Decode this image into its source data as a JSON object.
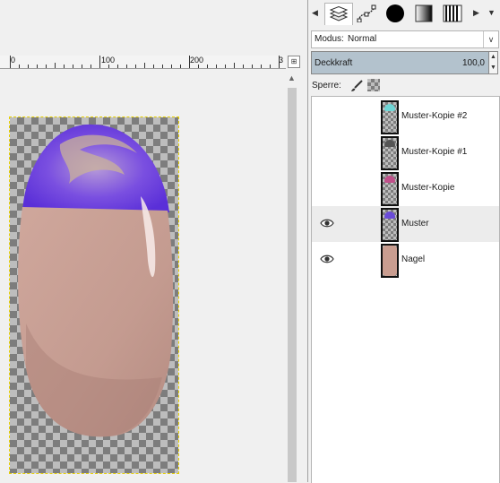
{
  "ruler": {
    "labels": [
      "0",
      "100",
      "200",
      "3"
    ]
  },
  "layers_panel": {
    "tabs": [
      {
        "name": "layers-tab",
        "icon": "layers-icon"
      },
      {
        "name": "paths-tab",
        "icon": "paths-icon"
      },
      {
        "name": "brushes-tab",
        "icon": "brush-circle-icon"
      },
      {
        "name": "gradients-tab",
        "icon": "gradient-icon"
      },
      {
        "name": "patterns-tab",
        "icon": "pattern-icon"
      }
    ],
    "mode_label": "Modus:",
    "mode_value": "Normal",
    "opacity_label": "Deckkraft",
    "opacity_value": "100,0",
    "lock_label": "Sperre:",
    "layers": [
      {
        "name": "Muster-Kopie #2",
        "visible": false,
        "selected": false,
        "thumb_color": "#6fd6d6"
      },
      {
        "name": "Muster-Kopie #1",
        "visible": false,
        "selected": false,
        "thumb_color": "#555555"
      },
      {
        "name": "Muster-Kopie",
        "visible": false,
        "selected": false,
        "thumb_color": "#c0508a"
      },
      {
        "name": "Muster",
        "visible": true,
        "selected": true,
        "thumb_color": "#6a4bd8"
      },
      {
        "name": "Nagel",
        "visible": true,
        "selected": false,
        "thumb_color": "#c99d90"
      }
    ]
  },
  "colors": {
    "nail_tip": "#6a3fe0",
    "nail_body": "#c79e93",
    "selection_marquee": "#e8d000",
    "opacity_bar": "#b3c2cd"
  }
}
